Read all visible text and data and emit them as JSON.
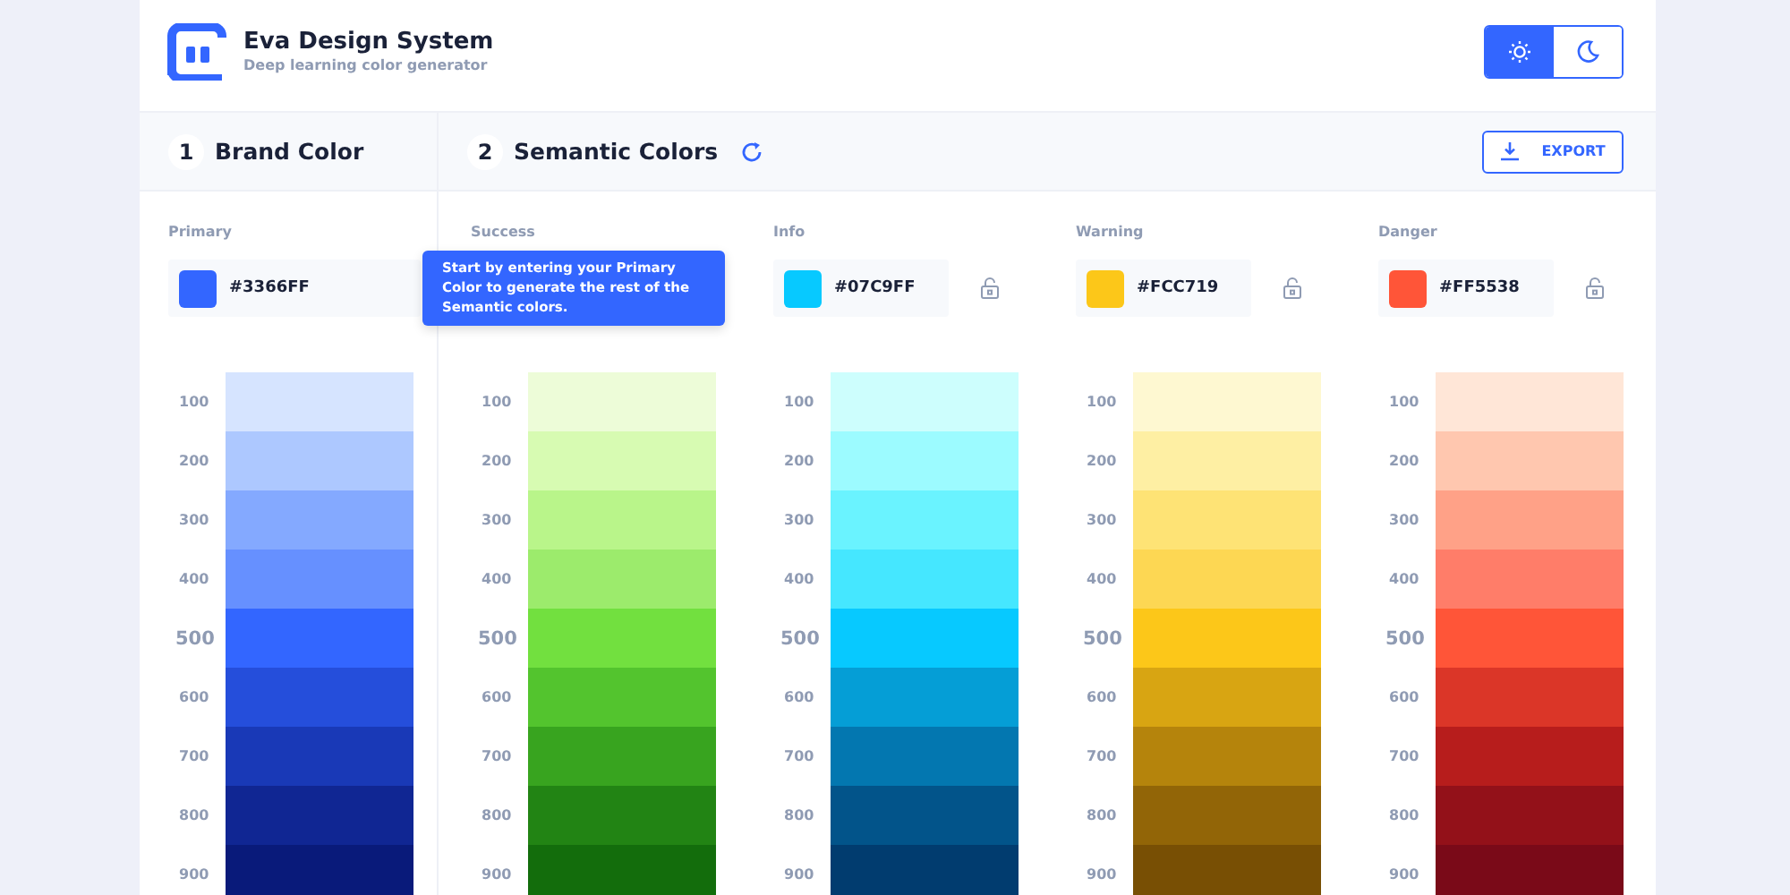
{
  "header": {
    "title": "Eva Design System",
    "subtitle": "Deep learning color generator"
  },
  "theme_toggle": [
    {
      "kind": "light",
      "selected": true
    },
    {
      "kind": "dark",
      "selected": false
    }
  ],
  "steps": [
    {
      "number": "1",
      "title": "Brand Color",
      "refresh": false
    },
    {
      "number": "2",
      "title": "Semantic Colors",
      "refresh": true
    }
  ],
  "export_button": "EXPORT",
  "tooltip": "Start by entering your Primary Color to generate the rest of the Semantic colors.",
  "columns": [
    {
      "label": "Primary",
      "hex": "#3366FF",
      "color": "#3366ff",
      "lock": false,
      "shades": [
        {
          "label": "100",
          "color": "#d6e4ff",
          "base": false
        },
        {
          "label": "200",
          "color": "#adc8ff",
          "base": false
        },
        {
          "label": "300",
          "color": "#84a9ff",
          "base": false
        },
        {
          "label": "400",
          "color": "#6690ff",
          "base": false
        },
        {
          "label": "500",
          "color": "#3366ff",
          "base": true
        },
        {
          "label": "600",
          "color": "#254edb",
          "base": false
        },
        {
          "label": "700",
          "color": "#1939b7",
          "base": false
        },
        {
          "label": "800",
          "color": "#102693",
          "base": false
        },
        {
          "label": "900",
          "color": "#091a7a",
          "base": false
        }
      ]
    },
    {
      "label": "Success",
      "lock": false,
      "shades": [
        {
          "label": "100",
          "color": "#edfcd8",
          "base": false
        },
        {
          "label": "200",
          "color": "#d7fbb2",
          "base": false
        },
        {
          "label": "300",
          "color": "#b9f58a",
          "base": false
        },
        {
          "label": "400",
          "color": "#9ceb6c",
          "base": false
        },
        {
          "label": "500",
          "color": "#72e03f",
          "base": true
        },
        {
          "label": "600",
          "color": "#53c42e",
          "base": false
        },
        {
          "label": "700",
          "color": "#38a41f",
          "base": false
        },
        {
          "label": "800",
          "color": "#228414",
          "base": false
        },
        {
          "label": "900",
          "color": "#136d0c",
          "base": false
        }
      ]
    },
    {
      "label": "Info",
      "hex": "#07C9FF",
      "color": "#07c9ff",
      "lock": true,
      "shades": [
        {
          "label": "100",
          "color": "#cdfefd",
          "base": false
        },
        {
          "label": "200",
          "color": "#9cfbff",
          "base": false
        },
        {
          "label": "300",
          "color": "#6af3ff",
          "base": false
        },
        {
          "label": "400",
          "color": "#45e7ff",
          "base": false
        },
        {
          "label": "500",
          "color": "#07c9ff",
          "base": true
        },
        {
          "label": "600",
          "color": "#059ed6",
          "base": false
        },
        {
          "label": "700",
          "color": "#0377b0",
          "base": false
        },
        {
          "label": "800",
          "color": "#02548a",
          "base": false
        },
        {
          "label": "900",
          "color": "#013c6f",
          "base": false
        }
      ]
    },
    {
      "label": "Warning",
      "hex": "#FCC719",
      "color": "#fcc719",
      "lock": true,
      "shades": [
        {
          "label": "100",
          "color": "#fef8d1",
          "base": false
        },
        {
          "label": "200",
          "color": "#feefa3",
          "base": false
        },
        {
          "label": "300",
          "color": "#fee375",
          "base": false
        },
        {
          "label": "400",
          "color": "#fdd753",
          "base": false
        },
        {
          "label": "500",
          "color": "#fcc719",
          "base": true
        },
        {
          "label": "600",
          "color": "#d8a512",
          "base": false
        },
        {
          "label": "700",
          "color": "#b5840c",
          "base": false
        },
        {
          "label": "800",
          "color": "#926507",
          "base": false
        },
        {
          "label": "900",
          "color": "#784f04",
          "base": false
        }
      ]
    },
    {
      "label": "Danger",
      "hex": "#FF5538",
      "color": "#ff5538",
      "lock": true,
      "shades": [
        {
          "label": "100",
          "color": "#ffe6d7",
          "base": false
        },
        {
          "label": "200",
          "color": "#ffc7af",
          "base": false
        },
        {
          "label": "300",
          "color": "#ffa187",
          "base": false
        },
        {
          "label": "400",
          "color": "#ff7d69",
          "base": false
        },
        {
          "label": "500",
          "color": "#ff5538",
          "base": true
        },
        {
          "label": "600",
          "color": "#db3628",
          "base": false
        },
        {
          "label": "700",
          "color": "#b71d1c",
          "base": false
        },
        {
          "label": "800",
          "color": "#931119",
          "base": false
        },
        {
          "label": "900",
          "color": "#7a0a18",
          "base": false
        }
      ]
    }
  ]
}
